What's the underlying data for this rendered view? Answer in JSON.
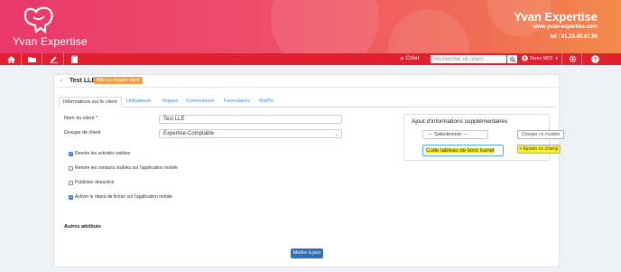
{
  "brand": {
    "logo_text": "Yvan Expertise",
    "name": "Yvan Expertise",
    "website": "www.yvan-expertise.com",
    "phone": "tel : 01.23.45.67.89"
  },
  "toolbar": {
    "create_label": "Créer",
    "search_placeholder": "Rechercher un client...",
    "user_label": "Demo MCF",
    "color": "#e21f2e"
  },
  "client": {
    "back_icon": "chevron-left-icon",
    "title": "Test LLE",
    "go_button": "Aller au dossier client"
  },
  "tabs": [
    {
      "label": "Informations sur le client",
      "active": true
    },
    {
      "label": "Utilisateurs"
    },
    {
      "label": "Rappel"
    },
    {
      "label": "Connecteurs"
    },
    {
      "label": "Formulaires"
    },
    {
      "label": "MailTo"
    }
  ],
  "form": {
    "name_label": "Nom du client *",
    "name_value": "Test LLE",
    "group_label": "Groupe de client",
    "group_value": "Expertise-Comptable",
    "checkboxes": [
      {
        "label": "Rendre les activités visibles",
        "checked": true
      },
      {
        "label": "Rendre les contacts visibles sur l'application mobile",
        "checked": false
      },
      {
        "label": "Publisher désactivé",
        "checked": false
      },
      {
        "label": "Activer le dépot de fichier sur l'application mobile",
        "checked": true
      }
    ],
    "other_attributes": "Autres attributs",
    "submit": "Mettre à jour"
  },
  "extra_info": {
    "title": "Ajout d'informations supplémentaires",
    "select_value": "--- Sélectionner ---",
    "load_model_button": "Charger ce modèle",
    "field_input_value": "Code tableau de bord Isanet",
    "add_field_button": "+ Ajouter ce champ",
    "highlight_color": "#f7f030"
  }
}
